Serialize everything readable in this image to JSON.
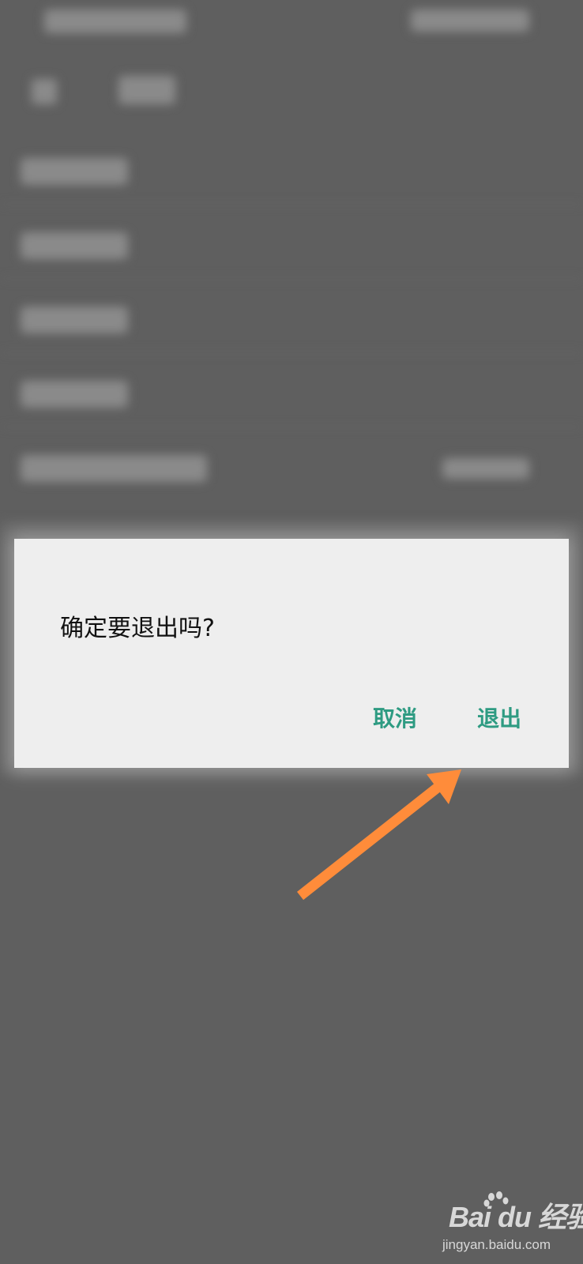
{
  "dialog": {
    "message": "确定要退出吗?",
    "cancel_label": "取消",
    "confirm_label": "退出"
  },
  "watermark": {
    "logo_text": "Bai du 经验",
    "domain": "jingyan.baidu.com"
  },
  "colors": {
    "overlay": "#5f5f5f",
    "dialog_bg": "#eeeeee",
    "accent": "#2e9b82",
    "annotation_arrow": "#ff8c3a"
  },
  "icons": {
    "paw": "baidu-paw-icon"
  }
}
